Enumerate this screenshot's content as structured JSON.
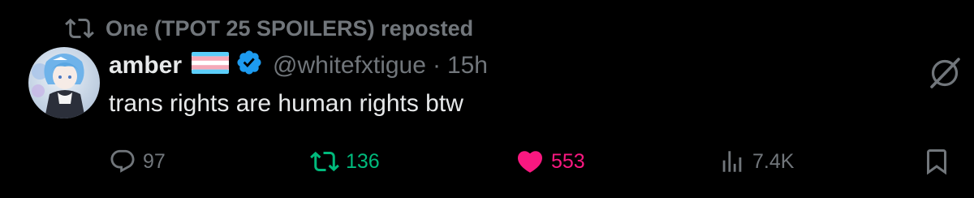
{
  "repost_header": {
    "icon": "repost-icon",
    "text": "One (TPOT 25 SPOILERS) reposted"
  },
  "author": {
    "avatar": "avatar-image",
    "display_name": "amber",
    "flag_icon": "trans-flag-icon",
    "verified_icon": "verified-badge-icon",
    "handle": "@whitefxtigue",
    "separator": "·",
    "time": "15h"
  },
  "post": {
    "text": "trans rights are human rights btw",
    "menu_icon": "grok-icon"
  },
  "actions": {
    "reply": {
      "icon": "reply-icon",
      "count": "97"
    },
    "repost": {
      "icon": "repost-icon",
      "count": "136",
      "active": true
    },
    "like": {
      "icon": "heart-icon",
      "count": "553",
      "active": true
    },
    "views": {
      "icon": "analytics-icon",
      "count": "7.4K"
    },
    "bookmark": {
      "icon": "bookmark-icon"
    }
  },
  "colors": {
    "background": "#000000",
    "text": "#e7e9ea",
    "muted": "#71767b",
    "repost_green": "#00ba7c",
    "like_pink": "#f91880",
    "verified_blue": "#1d9bf0",
    "flag_blue": "#5bcefa",
    "flag_pink": "#f5a9b8",
    "flag_white": "#ffffff"
  }
}
